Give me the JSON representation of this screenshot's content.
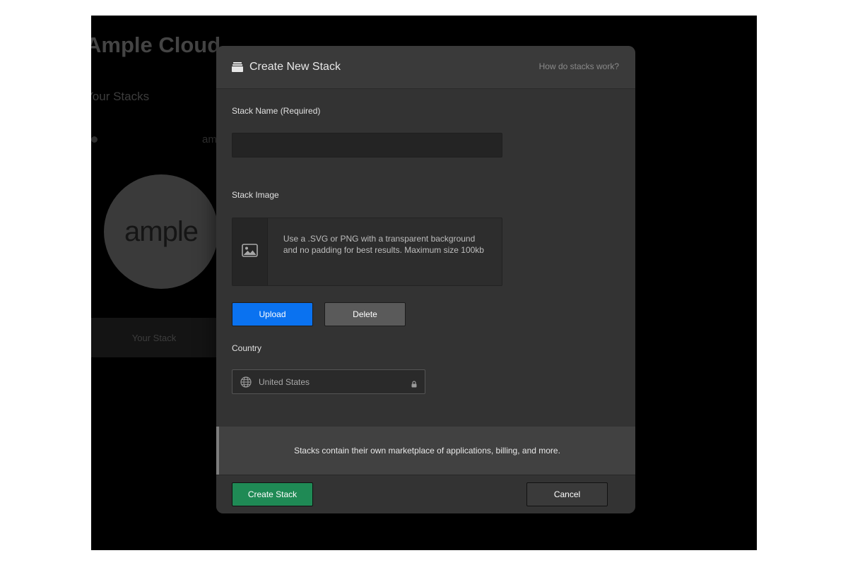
{
  "background": {
    "app_title": "Ample Cloud",
    "section_title": "Your Stacks",
    "tab_fragment": "am",
    "logo_text": "ample",
    "card_label": "Your Stack"
  },
  "modal": {
    "title": "Create New Stack",
    "help_link": "How do stacks work?",
    "stack_name_label": "Stack Name (Required)",
    "stack_name_value": "",
    "stack_image_label": "Stack Image",
    "image_hint": "Use a .SVG or PNG with a transparent background and no padding for best results. Maximum size 100kb",
    "upload_label": "Upload",
    "delete_label": "Delete",
    "country_label": "Country",
    "country_value": "United States",
    "info_text": "Stacks contain their own marketplace of applications, billing, and more.",
    "create_label": "Create Stack",
    "cancel_label": "Cancel"
  },
  "icons": {
    "header": "stack-icon",
    "image_placeholder": "image-icon",
    "country": "globe-icon",
    "locked": "lock-icon"
  },
  "colors": {
    "primary": "#0a72f0",
    "success": "#1f8a55",
    "modal_bg": "#333333"
  }
}
